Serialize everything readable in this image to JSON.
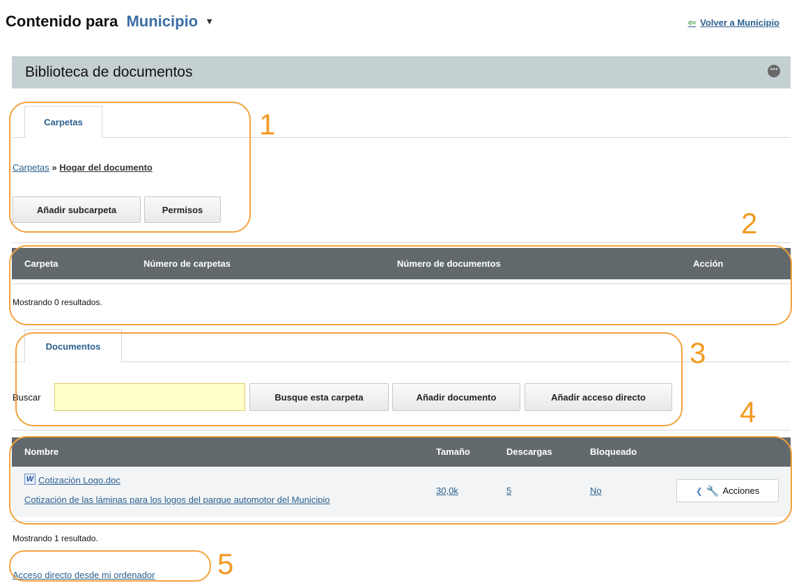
{
  "header": {
    "title_prefix": "Contenido para",
    "site_name": "Municipio",
    "caret": "▼",
    "back_link": "Volver a Municipio"
  },
  "portlet": {
    "title": "Biblioteca de documentos",
    "menu_glyph": "⋯"
  },
  "folders": {
    "tab_label": "Carpetas",
    "breadcrumb": {
      "root": "Carpetas",
      "separator": "»",
      "current": "Hogar del documento"
    },
    "add_subfolder_button": "Añadir subcarpeta",
    "permissions_button": "Permisos",
    "columns": [
      "Carpeta",
      "Número de carpetas",
      "Número de documentos",
      "Acción"
    ],
    "results_text": "Mostrando 0 resultados."
  },
  "documents": {
    "tab_label": "Documentos",
    "search_label": "Buscar",
    "search_value": "",
    "search_button": "Busque esta carpeta",
    "add_document_button": "Añadir documento",
    "add_shortcut_button": "Añadir acceso directo",
    "columns": [
      "Nombre",
      "Tamaño",
      "Descargas",
      "Bloqueado"
    ],
    "rows": [
      {
        "name": "Cotización Logo.doc",
        "description": "Cotización de las láminas para los logos del parque automotor del Municipio",
        "size": "30,0k",
        "downloads": "5",
        "locked": "No",
        "actions_label": "Acciones"
      }
    ],
    "results_text": "Mostrando 1 resultado."
  },
  "footer": {
    "shortcut_link": "Acceso directo desde mi ordenador"
  },
  "annotations": [
    "1",
    "2",
    "3",
    "4",
    "5"
  ],
  "colors": {
    "accent_link": "#2b5f8e",
    "table_header": "#62696d",
    "portlet_bar": "#c5d0d3",
    "annotation": "#f39a23",
    "search_field": "#ffffc9"
  },
  "icons": {
    "back": "green-left-arrow-icon",
    "doc": "word-document-icon",
    "actions": "wrench-icon"
  }
}
